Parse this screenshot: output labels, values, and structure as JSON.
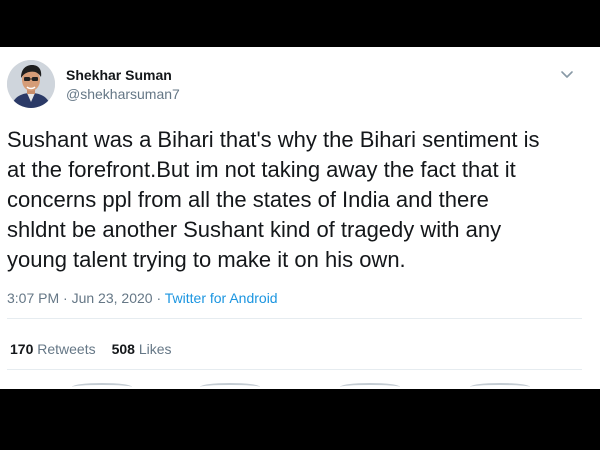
{
  "tweet": {
    "author": {
      "display_name": "Shekhar Suman",
      "handle": "@shekharsuman7"
    },
    "text_lines": [
      "Sushant was a Bihari that's why the Bihari sentiment is",
      "at the forefront.But im not taking away the fact that it",
      "concerns ppl from all the states of India and there",
      "shldnt be another Sushant kind of tragedy with any",
      "young talent trying to make it on his own."
    ],
    "time": "3:07 PM",
    "separator": "·",
    "date": "Jun 23, 2020",
    "source": "Twitter for Android",
    "retweets": {
      "count": "170",
      "label": "Retweets"
    },
    "likes": {
      "count": "508",
      "label": "Likes"
    },
    "menu_icon": "chevron-down-icon",
    "link_color": "#1b95e0"
  }
}
